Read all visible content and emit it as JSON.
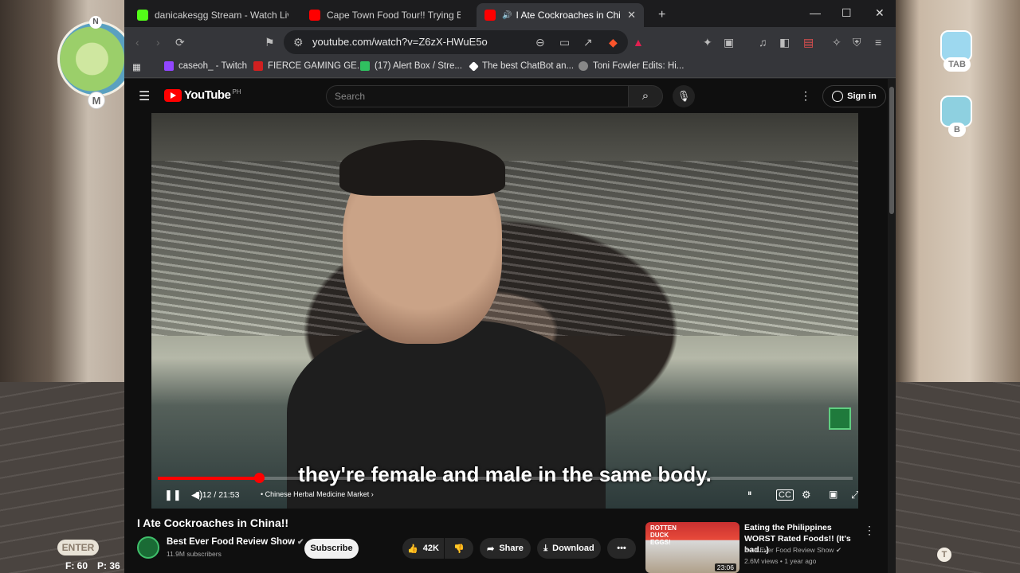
{
  "game": {
    "map_n": "N",
    "map_m": "M",
    "tab_label": "TAB",
    "b_label": "B",
    "enter_label": "ENTER",
    "f_label": "F: 60",
    "p_label": "P: 36",
    "t_label": "T"
  },
  "browser": {
    "tabs": [
      {
        "title": "danicakesgg Stream - Watch Live",
        "favicon_color": "#53fc18"
      },
      {
        "title": "Cape Town Food Tour!! Trying Best S",
        "favicon_color": "#ff0000"
      },
      {
        "title": "I Ate Cockroaches in China!! -",
        "favicon_color": "#ff0000"
      }
    ],
    "new_tab": "+",
    "url": "youtube.com/watch?v=Z6zX-HWuE5o",
    "bookmarks": [
      {
        "label": "caseoh_ - Twitch",
        "color": "#9146ff"
      },
      {
        "label": "FIERCE GAMING GE...",
        "color": "#d02020"
      },
      {
        "label": "(17) Alert Box / Stre...",
        "color": "#30c060"
      },
      {
        "label": "The best ChatBot an...",
        "color": "#ffffff"
      },
      {
        "label": "Toni Fowler Edits: Hi...",
        "color": "#888888"
      }
    ]
  },
  "youtube": {
    "logo_text": "YouTube",
    "country_code": "PH",
    "search_placeholder": "Search",
    "sign_in": "Sign in",
    "video": {
      "subtitle": "they're female and male in the same body.",
      "time": "3:12 / 21:53",
      "progress": 0.146,
      "chapter": "• Chinese Herbal Medicine Market",
      "title": "I Ate Cockroaches in China!!"
    },
    "channel": {
      "name": "Best Ever Food Review Show",
      "subs": "11.9M subscribers",
      "subscribe": "Subscribe"
    },
    "actions": {
      "likes": "42K",
      "share": "Share",
      "download": "Download",
      "more": "•••"
    },
    "recommended": {
      "thumb_text": "ROTTEN DUCK EGGS!",
      "duration": "23:06",
      "title": "Eating the Philippines WORST Rated Foods!! (It's bad...)",
      "channel": "Best Ever Food Review Show",
      "meta": "2.6M views • 1 year ago"
    }
  }
}
